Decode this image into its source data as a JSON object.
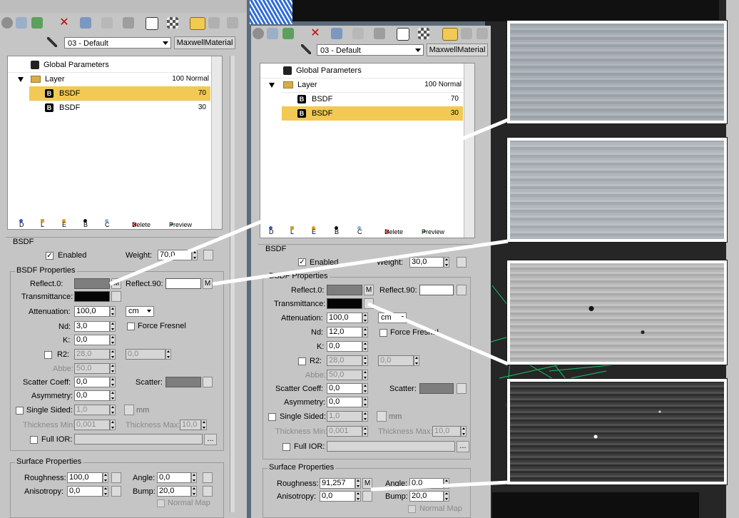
{
  "app": {
    "material_name": "03 - Default",
    "material_type": "MaxwellMaterial"
  },
  "tree": {
    "global_params": "Global Parameters",
    "layer_label": "Layer",
    "layer_info": "100 Normal",
    "bsdf1_label": "BSDF",
    "bsdf2_label": "BSDF",
    "b_glyph": "B"
  },
  "legend": {
    "d": "D",
    "l": "L",
    "e": "E",
    "b": "B",
    "c": "C",
    "delete": "Delete",
    "preview": "Preview"
  },
  "labels": {
    "bsdf_group": "BSDF",
    "enabled": "Enabled",
    "weight": "Weight:",
    "bsdf_props": "BSDF Properties",
    "reflect0": "Reflect.0:",
    "reflect90": "Reflect.90:",
    "transmittance": "Transmittance:",
    "attenuation": "Attenuation:",
    "nd": "Nd:",
    "force_fresnel": "Force Fresnel",
    "k": "K:",
    "r2": "R2:",
    "abbe": "Abbe:",
    "scatter_coeff": "Scatter Coeff:",
    "scatter": "Scatter:",
    "asymmetry": "Asymmetry:",
    "single_sided": "Single Sided:",
    "mm": "mm",
    "thickness_min": "Thickness Min:",
    "thickness_max": "Thickness Max:",
    "full_ior": "Full IOR:",
    "browse": "...",
    "surface_props": "Surface Properties",
    "roughness": "Roughness:",
    "angle": "Angle:",
    "anisotropy": "Anisotropy:",
    "bump": "Bump:",
    "normal_map": "Normal Map",
    "m": "M",
    "check": "✓"
  },
  "left": {
    "weight": "70,0",
    "attenuation": "100,0",
    "unit": "cm",
    "nd": "3,0",
    "k": "0,0",
    "r2a": "28,0",
    "r2b": "0,0",
    "abbe": "50,0",
    "scatter_coeff": "0,0",
    "asymmetry": "0,0",
    "single_sided": "1,0",
    "thickness_min": "0,001",
    "thickness_max": "10,0",
    "roughness": "100,0",
    "angle": "0,0",
    "anisotropy": "0,0",
    "bump": "20,0",
    "bsdf1_weight": "70",
    "bsdf2_weight": "30"
  },
  "right": {
    "weight": "30,0",
    "attenuation": "100,0",
    "unit": "cm",
    "nd": "12,0",
    "k": "0,0",
    "r2a": "28,0",
    "r2b": "0,0",
    "abbe": "50,0",
    "scatter_coeff": "0,0",
    "asymmetry": "0,0",
    "single_sided": "1,0",
    "thickness_min": "0,001",
    "thickness_max": "10,0",
    "roughness": "91,257",
    "angle": "0,0",
    "anisotropy": "0,0",
    "bump": "20,0",
    "bsdf1_weight": "70",
    "bsdf2_weight": "30"
  },
  "colors": {
    "selection": "#f1c954",
    "panel": "#c5c5c5",
    "viewport_dark": "#1a1a1a",
    "wire_green": "#19c46a",
    "wire_blue": "#2f6bd8"
  }
}
